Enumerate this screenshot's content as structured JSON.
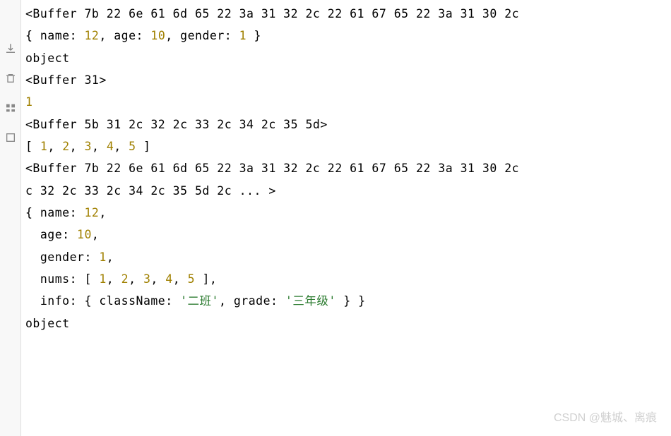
{
  "sidebar": {
    "icons": [
      "download-icon",
      "trash-icon",
      "panel-icon",
      "expand-icon"
    ]
  },
  "lines": {
    "l1": "<Buffer 7b 22 6e 61 6d 65 22 3a 31 32 2c 22 61 67 65 22 3a 31 30 2c",
    "l2a": "{ name: ",
    "l2b": "12",
    "l2c": ", age: ",
    "l2d": "10",
    "l2e": ", gender: ",
    "l2f": "1",
    "l2g": " }",
    "l3": "object",
    "l4": "<Buffer 31>",
    "l5": "1",
    "l6": "<Buffer 5b 31 2c 32 2c 33 2c 34 2c 35 5d>",
    "l7a": "[ ",
    "l7n1": "1",
    "l7s": ", ",
    "l7n2": "2",
    "l7n3": "3",
    "l7n4": "4",
    "l7n5": "5",
    "l7b": " ]",
    "l8": "<Buffer 7b 22 6e 61 6d 65 22 3a 31 32 2c 22 61 67 65 22 3a 31 30 2c",
    "l9": "c 32 2c 33 2c 34 2c 35 5d 2c ... >",
    "l10a": "{ name: ",
    "l10b": "12",
    "l10c": ",",
    "l11a": "  age: ",
    "l11b": "10",
    "l11c": ",",
    "l12a": "  gender: ",
    "l12b": "1",
    "l12c": ",",
    "l13a": "  nums: [ ",
    "l13n1": "1",
    "l13s": ", ",
    "l13n2": "2",
    "l13n3": "3",
    "l13n4": "4",
    "l13n5": "5",
    "l13b": " ],",
    "l14a": "  info: { className: ",
    "l14b": "'二班'",
    "l14c": ", grade: ",
    "l14d": "'三年级'",
    "l14e": " } }",
    "l15": "object"
  },
  "watermark": "CSDN @魅城、离痕"
}
